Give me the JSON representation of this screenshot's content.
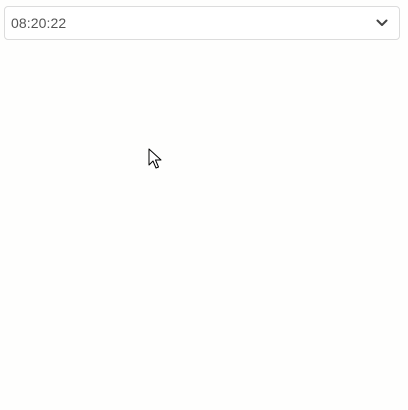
{
  "time_select": {
    "value": "08:20:22",
    "icon": "chevron-down-icon"
  },
  "cursor": {
    "icon": "mouse-pointer-icon"
  }
}
